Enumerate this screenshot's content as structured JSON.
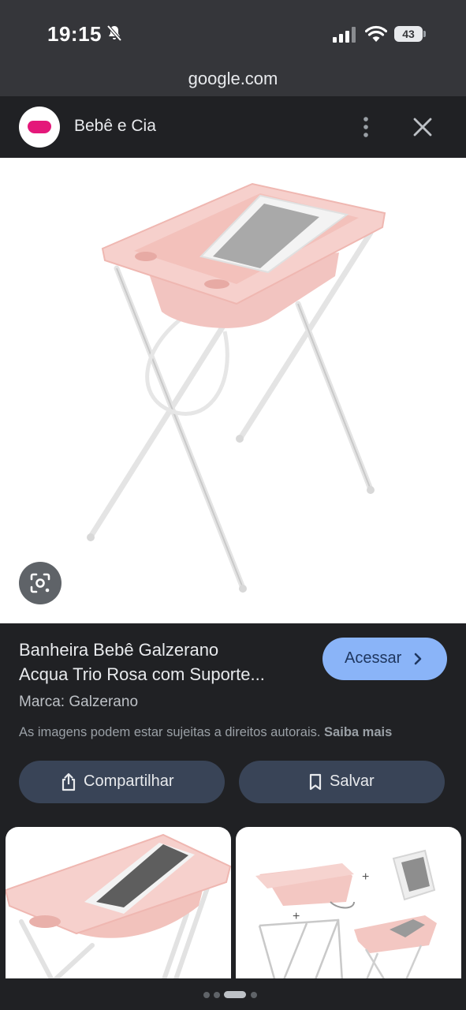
{
  "status_bar": {
    "time": "19:15",
    "battery": "43",
    "bell_icon": "bell-off-icon",
    "signal_icon": "signal-icon",
    "wifi_icon": "wifi-icon"
  },
  "browser": {
    "url": "google.com"
  },
  "header": {
    "site_name": "Bebê e Cia",
    "logo_color": "#e4187a",
    "more_icon": "more-vert-icon",
    "close_icon": "close-icon"
  },
  "image": {
    "lens_icon": "lens-icon"
  },
  "product": {
    "title_line1": "Banheira Bebê Galzerano",
    "title_line2": "Acqua Trio Rosa com Suporte...",
    "visit_label": "Acessar",
    "brand": "Marca: Galzerano",
    "copyright_text": "As imagens podem estar sujeitas a direitos autorais.",
    "learn_more": "Saiba mais",
    "share_label": "Compartilhar",
    "save_label": "Salvar",
    "visit_button_color": "#8ab4f8",
    "action_button_color": "#394457"
  },
  "pagination": {
    "dot_count": 4,
    "active_index": 2
  }
}
